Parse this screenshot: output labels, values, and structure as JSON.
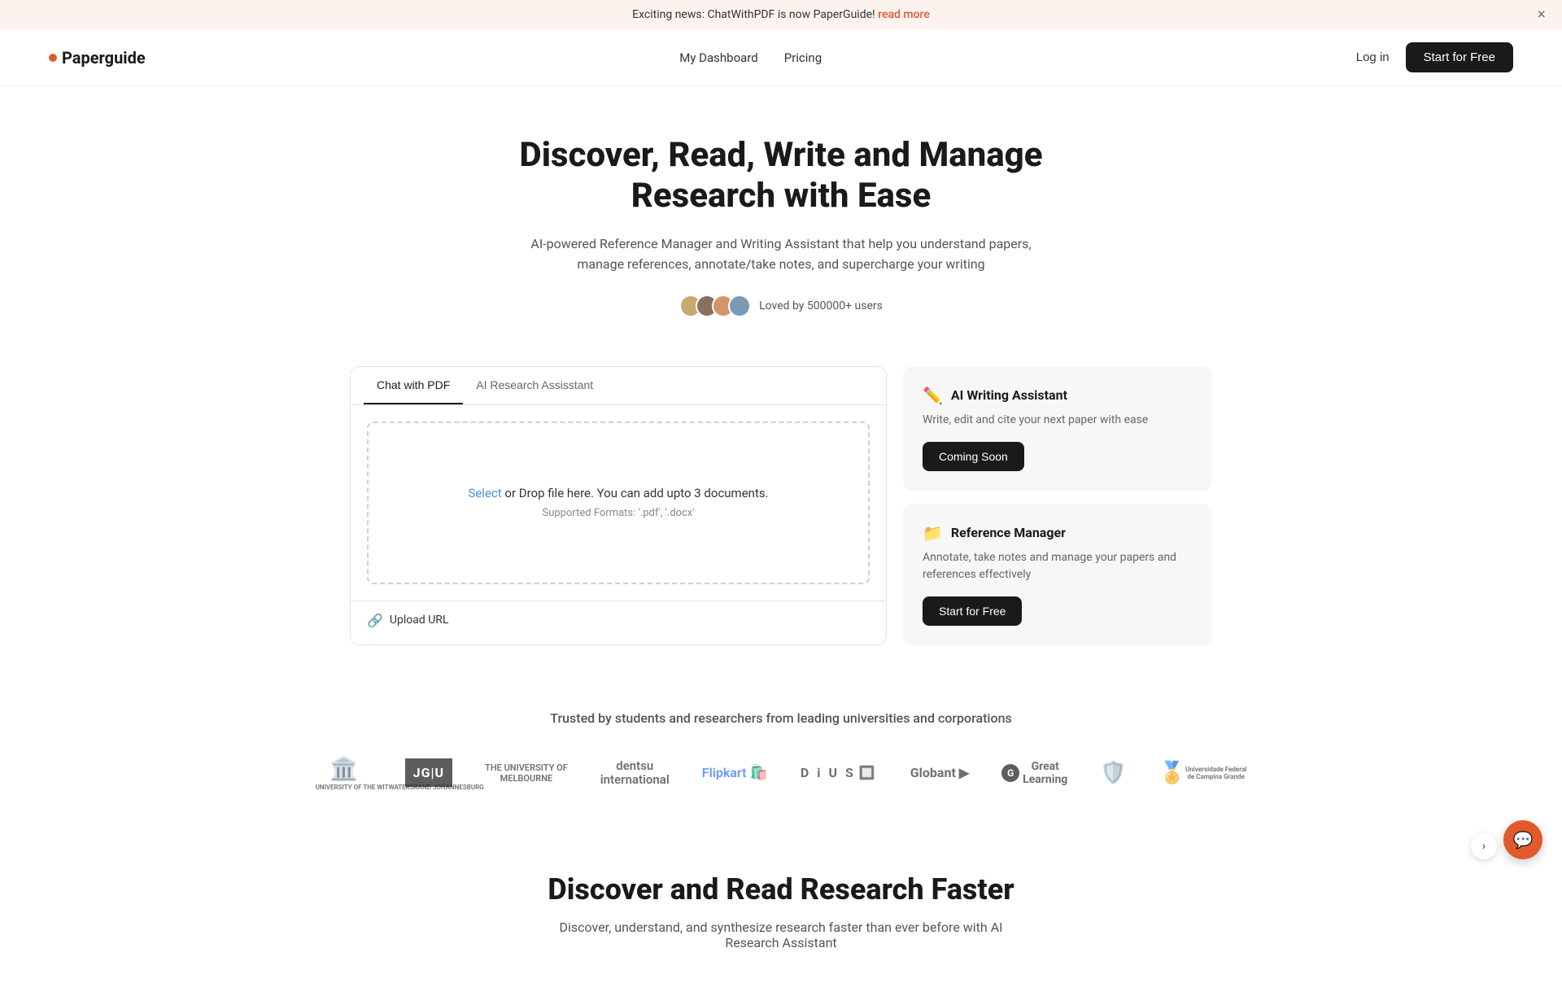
{
  "banner": {
    "text": "Exciting news: ChatWithPDF is now PaperGuide!",
    "link_text": "read more",
    "link_href": "#"
  },
  "navbar": {
    "logo_text": "Paperguide",
    "nav_links": [
      {
        "label": "My Dashboard",
        "href": "#"
      },
      {
        "label": "Pricing",
        "href": "#"
      }
    ],
    "login_label": "Log in",
    "start_label": "Start for Free"
  },
  "hero": {
    "title": "Discover, Read, Write and Manage Research with Ease",
    "subtitle": "AI-powered Reference Manager and Writing Assistant that help you understand papers, manage references, annotate/take notes, and supercharge your writing",
    "loved_text": "Loved by 500000+ users"
  },
  "tabs": [
    {
      "label": "Chat with PDF",
      "active": true
    },
    {
      "label": "AI Research Assisstant",
      "active": false
    }
  ],
  "dropzone": {
    "select_text": "Select",
    "main_text": " or Drop file here. You can add upto 3 documents.",
    "sub_text": "Supported Formats: '.pdf', '.docx'"
  },
  "upload_url": {
    "label": "Upload URL"
  },
  "feature_cards": [
    {
      "icon": "✏️",
      "title": "AI Writing Assistant",
      "description": "Write, edit and cite your next paper with ease",
      "button_label": "Coming Soon",
      "button_type": "coming_soon"
    },
    {
      "icon": "📁",
      "title": "Reference Manager",
      "description": "Annotate, take notes and manage your papers and references effectively",
      "button_label": "Start for Free",
      "button_type": "start_free"
    }
  ],
  "trusted": {
    "title": "Trusted by students and researchers from leading universities and corporations",
    "logos": [
      {
        "name": "University of Witwatersrand Johannesburg"
      },
      {
        "name": "JGU"
      },
      {
        "name": "The University of Melbourne"
      },
      {
        "name": "dentsu international"
      },
      {
        "name": "Flipkart"
      },
      {
        "name": "DIUS"
      },
      {
        "name": "Globant"
      },
      {
        "name": "Great Learning"
      },
      {
        "name": "University Shield"
      },
      {
        "name": "UFCG"
      }
    ]
  },
  "bottom": {
    "title": "Discover and Read Research Faster",
    "subtitle": "Discover, understand, and synthesize research faster than ever before with AI Research Assistant"
  },
  "chat_button": {
    "icon": "💬"
  }
}
